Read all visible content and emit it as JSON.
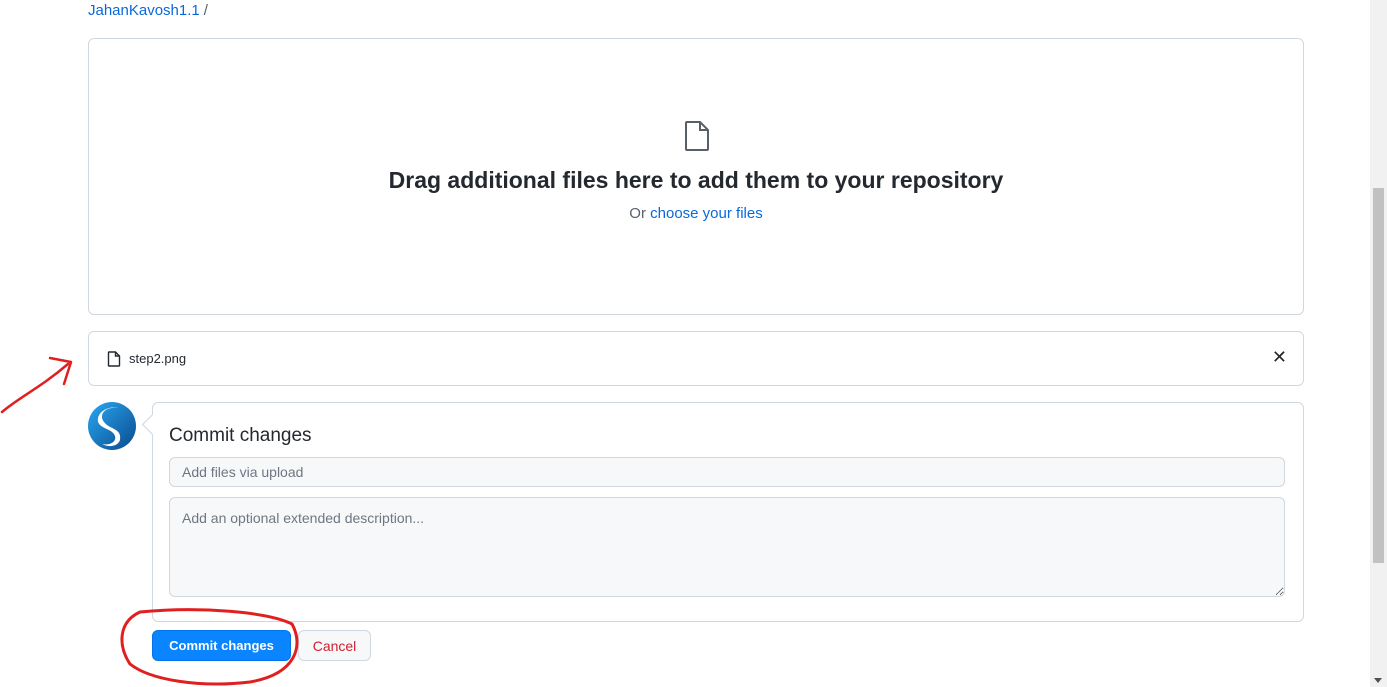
{
  "breadcrumb": {
    "repo": "JahanKavosh1.1",
    "separator": "/"
  },
  "dropzone": {
    "title": "Drag additional files here to add them to your repository",
    "or_text": "Or",
    "choose_link": "choose your files"
  },
  "file": {
    "name": "step2.png",
    "remove_glyph": "✕"
  },
  "commit": {
    "title": "Commit changes",
    "summary_placeholder": "Add files via upload",
    "description_placeholder": "Add an optional extended description...",
    "commit_button": "Commit changes",
    "cancel_button": "Cancel"
  },
  "icons": {
    "file": "file-icon",
    "remove": "close-icon",
    "avatar": "user-avatar"
  },
  "colors": {
    "link": "#0969da",
    "primary_button": "#0a85ff",
    "cancel_text": "#cf222e",
    "annotation": "#e02020"
  }
}
